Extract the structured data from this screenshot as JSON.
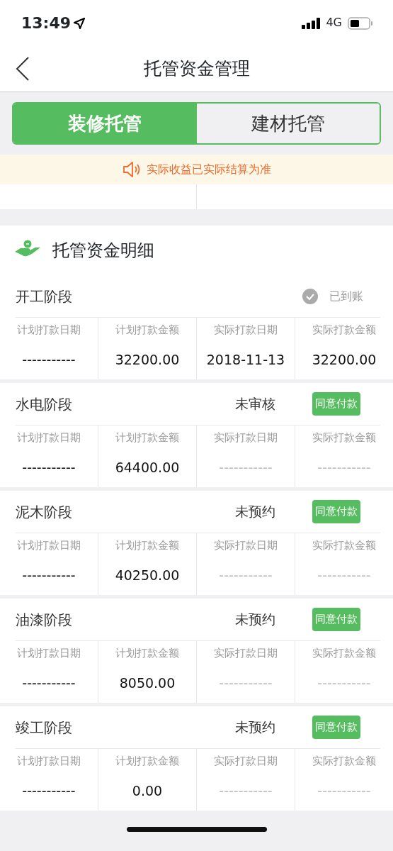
{
  "status_bar": {
    "time": "13:49",
    "network": "4G"
  },
  "nav": {
    "title": "托管资金管理"
  },
  "tabs": [
    {
      "label": "装修托管",
      "selected": true
    },
    {
      "label": "建材托管",
      "selected": false
    }
  ],
  "notice": "实际收益已实际结算为准",
  "section": {
    "title": "托管资金明细"
  },
  "stages": [
    {
      "name": "开工阶段",
      "status": "已到账",
      "kind": "paid",
      "cells": [
        {
          "label": "计划打款日期",
          "value": "-----------",
          "muted": false
        },
        {
          "label": "计划打款金额",
          "value": "32200.00",
          "muted": false
        },
        {
          "label": "实际打款日期",
          "value": "2018-11-13",
          "muted": false
        },
        {
          "label": "实际打款金额",
          "value": "32200.00",
          "muted": false
        }
      ]
    },
    {
      "name": "水电阶段",
      "status": "未审核",
      "kind": "pending",
      "button": "同意付款",
      "cells": [
        {
          "label": "计划打款日期",
          "value": "-----------",
          "muted": false
        },
        {
          "label": "计划打款金额",
          "value": "64400.00",
          "muted": false
        },
        {
          "label": "实际打款日期",
          "value": "-----------",
          "muted": true
        },
        {
          "label": "实际打款金额",
          "value": "-----------",
          "muted": true
        }
      ]
    },
    {
      "name": "泥木阶段",
      "status": "未预约",
      "kind": "pending",
      "button": "同意付款",
      "cells": [
        {
          "label": "计划打款日期",
          "value": "-----------",
          "muted": false
        },
        {
          "label": "计划打款金额",
          "value": "40250.00",
          "muted": false
        },
        {
          "label": "实际打款日期",
          "value": "-----------",
          "muted": true
        },
        {
          "label": "实际打款金额",
          "value": "-----------",
          "muted": true
        }
      ]
    },
    {
      "name": "油漆阶段",
      "status": "未预约",
      "kind": "pending",
      "button": "同意付款",
      "cells": [
        {
          "label": "计划打款日期",
          "value": "-----------",
          "muted": false
        },
        {
          "label": "计划打款金额",
          "value": "8050.00",
          "muted": false
        },
        {
          "label": "实际打款日期",
          "value": "-----------",
          "muted": true
        },
        {
          "label": "实际打款金额",
          "value": "-----------",
          "muted": true
        }
      ]
    },
    {
      "name": "竣工阶段",
      "status": "未预约",
      "kind": "pending",
      "button": "同意付款",
      "cells": [
        {
          "label": "计划打款日期",
          "value": "-----------",
          "muted": false
        },
        {
          "label": "计划打款金额",
          "value": "0.00",
          "muted": false
        },
        {
          "label": "实际打款日期",
          "value": "-----------",
          "muted": true
        },
        {
          "label": "实际打款金额",
          "value": "-----------",
          "muted": true
        }
      ]
    }
  ]
}
